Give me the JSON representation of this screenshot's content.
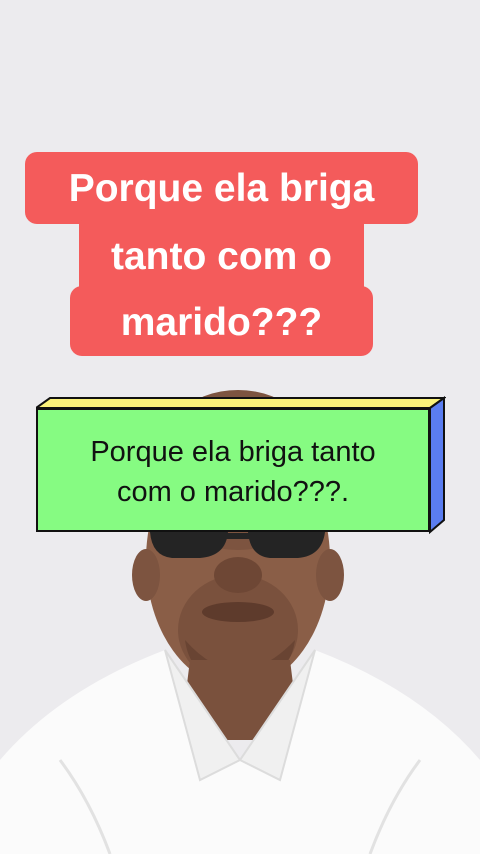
{
  "video_frame": {
    "background_color": "#ecebee",
    "person": "man in white shirt"
  },
  "top_caption": {
    "lines": [
      "Porque ela briga",
      "tanto com o",
      "marido???"
    ],
    "background_color": "#f45b5b",
    "text_color": "#ffffff"
  },
  "box_caption": {
    "lines": [
      "Porque ela briga tanto",
      "com o marido???."
    ],
    "front_color": "#86fb82",
    "top_color": "#fbf27a",
    "side_color": "#5a7df0"
  }
}
